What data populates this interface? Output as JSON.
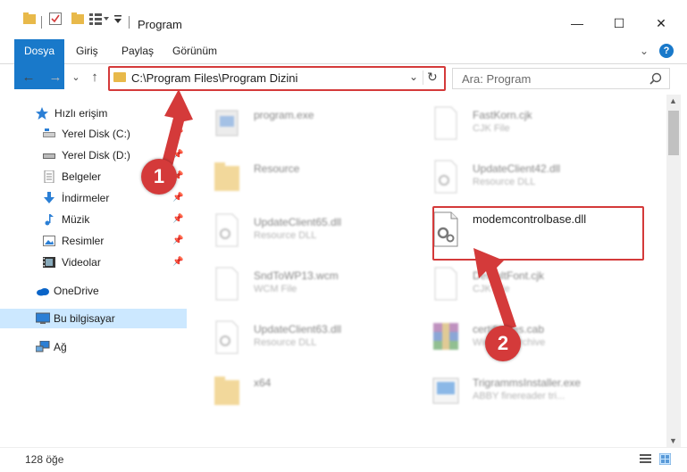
{
  "window": {
    "title": "Program",
    "minimize": "—",
    "maximize": "☐",
    "close": "✕"
  },
  "ribbon": {
    "tabs": [
      "Dosya",
      "Giriş",
      "Paylaş",
      "Görünüm"
    ],
    "expand": "⌄",
    "help": "?"
  },
  "address": {
    "path": "C:\\Program Files\\Program Dizini",
    "dropdown": "⌄",
    "refresh": "↻"
  },
  "search": {
    "placeholder": "Ara: Program",
    "icon": "search-icon"
  },
  "nav": {
    "back": "←",
    "forward": "→",
    "recent": "⌄",
    "up": "↑",
    "items": [
      {
        "label": "Hızlı erişim",
        "icon": "star-icon"
      },
      {
        "label": "Yerel Disk (C:)",
        "icon": "drive-icon",
        "pinned": true
      },
      {
        "label": "Yerel Disk (D:)",
        "icon": "drive-icon",
        "pinned": true
      },
      {
        "label": "Belgeler",
        "icon": "documents-icon",
        "pinned": true
      },
      {
        "label": "İndirmeler",
        "icon": "download-icon",
        "pinned": true
      },
      {
        "label": "Müzik",
        "icon": "music-icon",
        "pinned": true
      },
      {
        "label": "Resimler",
        "icon": "pictures-icon",
        "pinned": true
      },
      {
        "label": "Videolar",
        "icon": "videos-icon",
        "pinned": true
      },
      {
        "label": "OneDrive",
        "icon": "cloud-icon"
      },
      {
        "label": "Bu bilgisayar",
        "icon": "computer-icon",
        "selected": true
      },
      {
        "label": "Ağ",
        "icon": "network-icon"
      }
    ]
  },
  "files": [
    {
      "name": "program.exe",
      "type": ""
    },
    {
      "name": "FastKorn.cjk",
      "type": "CJK File"
    },
    {
      "name": "Resource",
      "type": ""
    },
    {
      "name": "UpdateClient42.dll",
      "type": "Resource DLL"
    },
    {
      "name": "UpdateClient65.dll",
      "type": "Resource DLL"
    },
    {
      "name": "modemcontrolbase.dll",
      "type": ""
    },
    {
      "name": "SndToWP13.wcm",
      "type": "WCM File"
    },
    {
      "name": "DefaultFont.cjk",
      "type": "CJK File"
    },
    {
      "name": "UpdateClient63.dll",
      "type": "Resource DLL"
    },
    {
      "name": "certificates.cab",
      "type": "WinRAR Archive"
    },
    {
      "name": "x64",
      "type": ""
    },
    {
      "name": "TrigrammsInstaller.exe",
      "type": "ABBY finereader tri..."
    }
  ],
  "status": {
    "count": "128 öğe"
  },
  "annotations": {
    "step1": "1",
    "step2": "2"
  },
  "colors": {
    "accent": "#1979ca",
    "highlight": "#d43a3a",
    "selection": "#cce8ff"
  }
}
